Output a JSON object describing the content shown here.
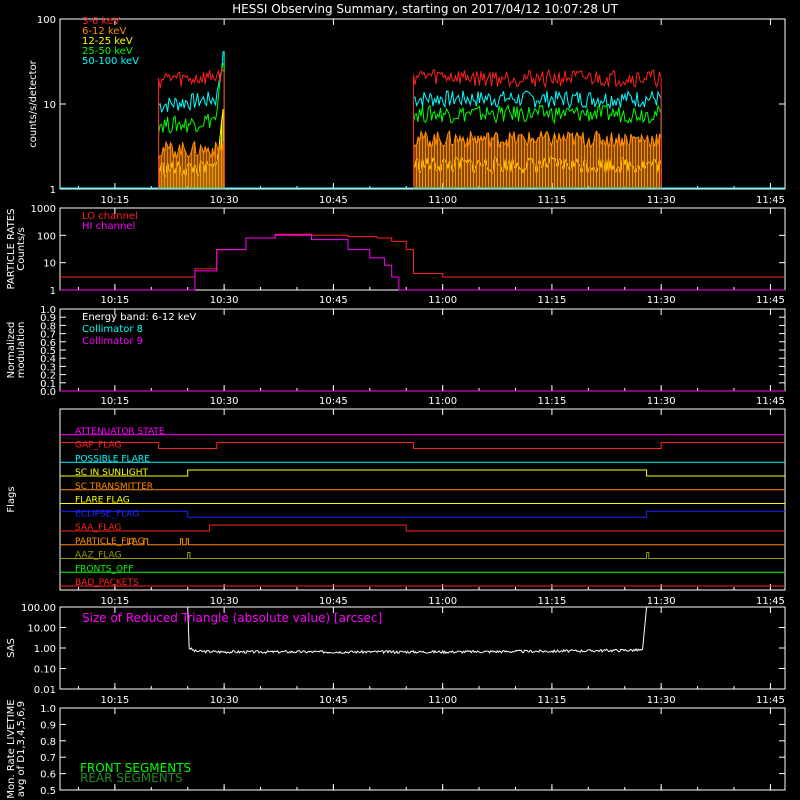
{
  "title": "HESSI Observing Summary, starting on 2017/04/12 10:07:28 UT",
  "time_ticks": [
    "10:15",
    "10:30",
    "10:45",
    "11:00",
    "11:15",
    "11:30",
    "11:45"
  ],
  "colors": {
    "background": "#000000",
    "axis": "#ffffff",
    "red": "#ff2020",
    "orange": "#ff8c00",
    "yellow": "#ffff00",
    "green": "#00ff00",
    "cyan": "#00ffff",
    "magenta": "#ff00ff",
    "blue": "#2020ff",
    "dark_green": "#228b22"
  },
  "chart_data": [
    {
      "id": "count-rates",
      "type": "line",
      "ylabel": "counts/s/detector",
      "yscale": "log",
      "ylim": [
        1,
        100
      ],
      "yticks": [
        "1",
        "10",
        "100"
      ],
      "xlim": [
        "10:07:28",
        "11:47:00"
      ],
      "legend_position": "top-left",
      "intervals": [
        [
          "10:21",
          "10:30"
        ],
        [
          "10:56",
          "11:30"
        ]
      ],
      "series": [
        {
          "name": "3-6 keV",
          "color": "#ff2020",
          "segments": [
            {
              "x": [
                "10:21",
                "10:23",
                "10:25",
                "10:27",
                "10:29",
                "10:30"
              ],
              "y": [
                20,
                21,
                20,
                21,
                22,
                24
              ]
            },
            {
              "x": [
                "10:56",
                "11:00",
                "11:05",
                "11:10",
                "11:15",
                "11:20",
                "11:25",
                "11:30"
              ],
              "y": [
                22,
                22,
                21,
                21,
                21,
                21,
                21,
                21
              ]
            }
          ]
        },
        {
          "name": "6-12 keV",
          "color": "#ff8c00",
          "segments": [
            {
              "x": [
                "10:21",
                "10:25",
                "10:29",
                "10:30"
              ],
              "y": [
                3,
                3,
                3,
                3.5
              ]
            },
            {
              "x": [
                "10:56",
                "11:00",
                "11:10",
                "11:20",
                "11:30"
              ],
              "y": [
                4,
                4,
                4,
                4,
                4
              ]
            }
          ]
        },
        {
          "name": "12-25 keV",
          "color": "#ffff00",
          "segments": [
            {
              "x": [
                "10:21",
                "10:25",
                "10:29",
                "10:30"
              ],
              "y": [
                1.8,
                1.8,
                1.8,
                9
              ]
            },
            {
              "x": [
                "10:56",
                "11:00",
                "11:10",
                "11:20",
                "11:30"
              ],
              "y": [
                2,
                2,
                2,
                2,
                2
              ]
            }
          ]
        },
        {
          "name": "25-50 keV",
          "color": "#00ff00",
          "segments": [
            {
              "x": [
                "10:21",
                "10:25",
                "10:29",
                "10:30"
              ],
              "y": [
                6,
                6,
                7,
                30
              ]
            },
            {
              "x": [
                "10:56",
                "11:00",
                "11:10",
                "11:20",
                "11:30"
              ],
              "y": [
                8,
                8,
                8,
                8,
                8
              ]
            }
          ]
        },
        {
          "name": "50-100 keV",
          "color": "#00ffff",
          "segments": [
            {
              "x": [
                "10:21",
                "10:25",
                "10:29",
                "10:30"
              ],
              "y": [
                10,
                11,
                12,
                40
              ]
            },
            {
              "x": [
                "10:56",
                "11:00",
                "11:10",
                "11:20",
                "11:30"
              ],
              "y": [
                12,
                12,
                12,
                12,
                12
              ]
            }
          ]
        }
      ]
    },
    {
      "id": "particle-rates",
      "type": "line",
      "ylabel": "PARTICLE RATES Counts/s",
      "yscale": "log",
      "ylim": [
        1,
        1000
      ],
      "yticks": [
        "1",
        "10",
        "100",
        "1000"
      ],
      "legend_position": "top-left",
      "series": [
        {
          "name": "LO channel",
          "color": "#ff2020",
          "x": [
            "10:07:28",
            "10:15",
            "10:22",
            "10:26",
            "10:29",
            "10:33",
            "10:37",
            "10:42",
            "10:47",
            "10:51",
            "10:53",
            "10:55",
            "10:56",
            "11:00",
            "11:10",
            "11:20",
            "11:30",
            "11:40",
            "11:47"
          ],
          "y": [
            3,
            3,
            3,
            6,
            30,
            80,
            110,
            100,
            90,
            80,
            60,
            30,
            4,
            3,
            3,
            3,
            3,
            3,
            3
          ]
        },
        {
          "name": "HI channel",
          "color": "#ff00ff",
          "x": [
            "10:07:28",
            "10:15",
            "10:22",
            "10:24",
            "10:26",
            "10:29",
            "10:33",
            "10:37",
            "10:42",
            "10:47",
            "10:50",
            "10:52",
            "10:53",
            "10:54",
            "11:00",
            "11:47"
          ],
          "y": [
            1,
            1,
            1,
            1,
            5,
            30,
            80,
            100,
            70,
            30,
            15,
            8,
            3,
            1,
            1,
            1
          ]
        }
      ]
    },
    {
      "id": "modulation",
      "type": "line",
      "ylabel": "Normalized modulation",
      "ylim": [
        0,
        1
      ],
      "yticks": [
        "0.0",
        "0.1",
        "0.2",
        "0.3",
        "0.4",
        "0.5",
        "0.6",
        "0.7",
        "0.8",
        "0.9",
        "1.0"
      ],
      "annotation": "Energy band: 6-12 keV",
      "legend_position": "top-left",
      "series": [
        {
          "name": "Collimator 8",
          "color": "#00ffff",
          "x": [],
          "y": []
        },
        {
          "name": "Collimator 9",
          "color": "#ff00ff",
          "x": [
            "10:07:28",
            "11:47:00"
          ],
          "y": [
            0,
            0
          ]
        }
      ]
    },
    {
      "id": "flags",
      "type": "line",
      "ylabel": "Flags",
      "series": [
        {
          "name": "ATTENUATOR STATE",
          "color": "#ff00ff",
          "x": [
            "10:07:28",
            "11:47:00"
          ],
          "y": [
            0,
            0
          ]
        },
        {
          "name": "GAP_FLAG",
          "color": "#ff2020",
          "x": [
            "10:07:28",
            "10:21",
            "10:21",
            "10:29",
            "10:29",
            "10:56",
            "10:56",
            "11:30",
            "11:30",
            "11:47:00"
          ],
          "y": [
            1,
            1,
            0,
            0,
            1,
            1,
            0,
            0,
            1,
            1
          ]
        },
        {
          "name": "POSSIBLE FLARE",
          "color": "#00ffff",
          "x": [
            "10:07:28",
            "11:47:00"
          ],
          "y": [
            0,
            0
          ]
        },
        {
          "name": "SC IN SUNLIGHT",
          "color": "#ffff00",
          "x": [
            "10:07:28",
            "10:25",
            "10:25",
            "11:28",
            "11:28",
            "11:47:00"
          ],
          "y": [
            0,
            0,
            1,
            1,
            0,
            0
          ]
        },
        {
          "name": "SC TRANSMITTER",
          "color": "#ff8c00",
          "x": [
            "10:07:28",
            "11:47:00"
          ],
          "y": [
            0,
            0
          ]
        },
        {
          "name": "FLARE FLAG",
          "color": "#ffff00",
          "x": [
            "10:07:28",
            "11:47:00"
          ],
          "y": [
            0,
            0
          ]
        },
        {
          "name": "ECLIPSE_FLAG",
          "color": "#2020ff",
          "x": [
            "10:07:28",
            "10:25",
            "10:25",
            "11:28",
            "11:28",
            "11:47:00"
          ],
          "y": [
            1,
            1,
            0,
            0,
            1,
            1
          ]
        },
        {
          "name": "SAA_FLAG",
          "color": "#ff2020",
          "x": [
            "10:07:28",
            "10:28",
            "10:28",
            "10:55",
            "10:55",
            "11:47:00"
          ],
          "y": [
            0,
            0,
            1,
            1,
            0,
            0
          ]
        },
        {
          "name": "PARTICLE_FLAG",
          "color": "#ff8c00",
          "x": [
            "10:07:28",
            "10:17",
            "10:17",
            "10:17.5",
            "10:17.5",
            "10:19",
            "10:19",
            "10:19.5",
            "10:19.5",
            "10:24",
            "10:24",
            "10:24.3",
            "10:24.3",
            "10:24.8",
            "10:24.8",
            "10:25.1",
            "10:25.1",
            "11:47:00"
          ],
          "y": [
            0,
            0,
            1,
            1,
            0,
            0,
            1,
            1,
            0,
            0,
            1,
            1,
            0,
            0,
            1,
            1,
            0,
            0
          ]
        },
        {
          "name": "AAZ_FLAG",
          "color": "#9a9a00",
          "x": [
            "10:07:28",
            "10:25",
            "10:25",
            "10:25.3",
            "10:25.3",
            "11:28",
            "11:28",
            "11:28.3",
            "11:28.3",
            "11:47:00"
          ],
          "y": [
            0,
            0,
            1,
            1,
            0,
            0,
            1,
            1,
            0,
            0
          ]
        },
        {
          "name": "FRONTS_OFF",
          "color": "#00ff00",
          "x": [
            "10:07:28",
            "11:47:00"
          ],
          "y": [
            0,
            0
          ]
        },
        {
          "name": "BAD_PACKETS",
          "color": "#ff2020",
          "x": [
            "10:07:28",
            "11:47:00"
          ],
          "y": [
            0,
            0
          ]
        }
      ]
    },
    {
      "id": "sas",
      "type": "line",
      "ylabel": "SAS",
      "yscale": "log",
      "ylim": [
        0.01,
        100
      ],
      "yticks": [
        "0.01",
        "0.10",
        "1.00",
        "10.00",
        "100.00"
      ],
      "annotation": "Size of Reduced Triangle (absolute value) [arcsec]",
      "series": [
        {
          "name": "",
          "color": "#ffffff",
          "x": [
            "10:25",
            "10:25.2",
            "10:26",
            "10:30",
            "10:45",
            "11:00",
            "11:15",
            "11:27.5",
            "11:28"
          ],
          "y": [
            100,
            1,
            0.7,
            0.65,
            0.65,
            0.65,
            0.7,
            0.8,
            100
          ]
        }
      ]
    },
    {
      "id": "livetime",
      "type": "line",
      "ylabel": "Mon. Rate LIVETIME avg of D1,3,4,5,6,9",
      "ylim": [
        0.5,
        1.0
      ],
      "yticks": [
        "0.5",
        "0.6",
        "0.7",
        "0.8",
        "0.9",
        "1.0"
      ],
      "legend_position": "bottom-left",
      "series": [
        {
          "name": "FRONT SEGMENTS",
          "color": "#00ff00",
          "x": [],
          "y": []
        },
        {
          "name": "REAR SEGMENTS",
          "color": "#228b22",
          "x": [],
          "y": []
        }
      ]
    }
  ]
}
